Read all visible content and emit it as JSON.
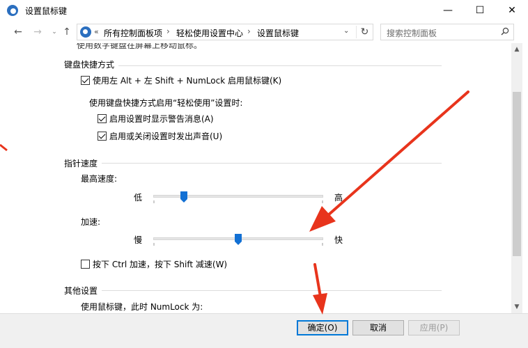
{
  "window": {
    "title": "设置鼠标键",
    "min_glyph": "—",
    "max_glyph": "☐",
    "close_glyph": "✕"
  },
  "nav": {
    "back_glyph": "←",
    "forward_glyph": "→",
    "recent_glyph": "⌄",
    "up_glyph": "↑",
    "overflow": "«",
    "breadcrumbs": [
      "所有控制面板项",
      "轻松使用设置中心",
      "设置鼠标键"
    ],
    "separator": "›",
    "dropdown_glyph": "⌄",
    "refresh_glyph": "↻",
    "search_placeholder": "搜索控制面板"
  },
  "content": {
    "clipped_text": "使用数字键盘在屏幕上移动鼠标。",
    "keyboard_shortcut": {
      "heading": "键盘快捷方式",
      "enable_shortcut": {
        "label": "使用左 Alt + 左 Shift + NumLock 启用鼠标键(K)",
        "checked": true
      },
      "subheading": "使用键盘快捷方式启用“轻松使用”设置时:",
      "show_warning": {
        "label": "启用设置时显示警告消息(A)",
        "checked": true
      },
      "play_sound": {
        "label": "启用或关闭设置时发出声音(U)",
        "checked": true
      }
    },
    "pointer_speed": {
      "heading": "指针速度",
      "top_speed": {
        "label": "最高速度:",
        "min_label": "低",
        "max_label": "高",
        "value": 0.18
      },
      "acceleration": {
        "label": "加速:",
        "min_label": "慢",
        "max_label": "快",
        "value": 0.5
      },
      "ctrl_shift": {
        "label": "按下 Ctrl 加速，按下 Shift 减速(W)",
        "checked": false
      }
    },
    "other": {
      "heading": "其他设置",
      "numlock_text": "使用鼠标键，此时 NumLock 为:"
    }
  },
  "footer": {
    "ok": "确定(O)",
    "cancel": "取消",
    "apply": "应用(P)"
  },
  "colors": {
    "accent": "#0078d7",
    "slider_thumb": "#1270d4",
    "annotation_arrow": "#e8341c"
  }
}
